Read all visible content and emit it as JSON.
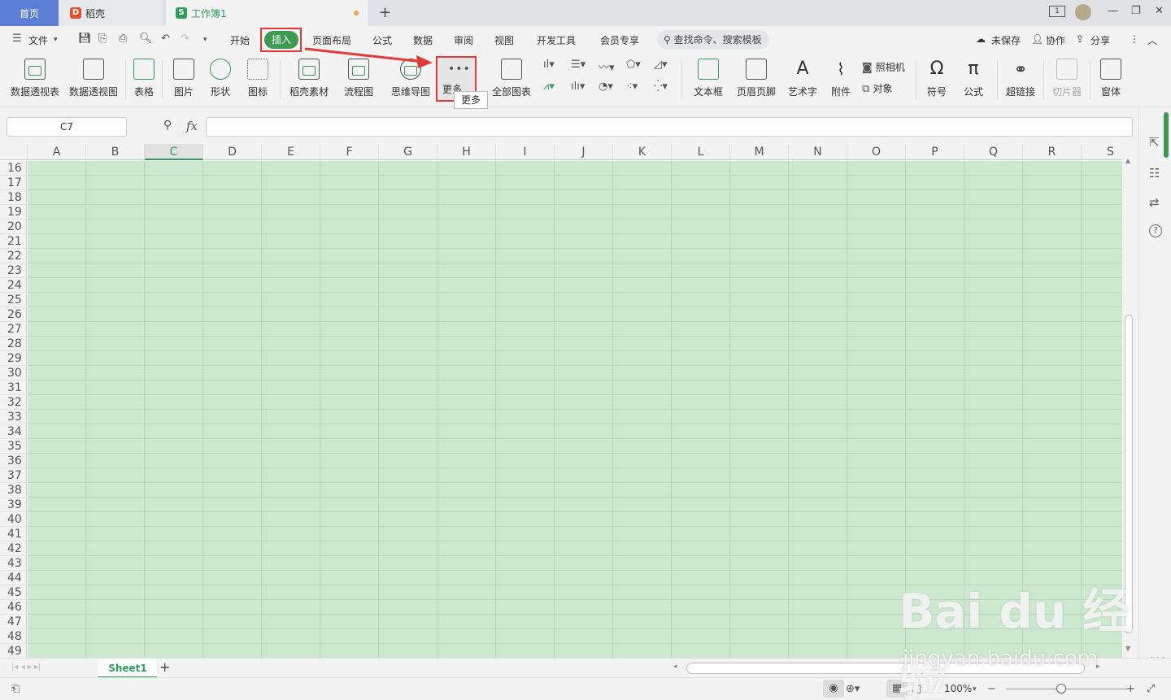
{
  "tabs": {
    "home": "首页",
    "daoke": "稻壳",
    "workbook": "工作簿1"
  },
  "menubar": {
    "file": "文件",
    "items": [
      "开始",
      "插入",
      "页面布局",
      "公式",
      "数据",
      "审阅",
      "视图",
      "开发工具",
      "会员专享"
    ],
    "search": "查找命令、搜索模板",
    "unsaved": "未保存",
    "collab": "协作",
    "share": "分享"
  },
  "ribbon": {
    "pivot_table": "数据透视表",
    "pivot_chart": "数据透视图",
    "table": "表格",
    "picture": "图片",
    "shape": "形状",
    "icon": "图标",
    "daoke_material": "稻壳素材",
    "flowchart": "流程图",
    "mindmap": "思维导图",
    "more": "更多",
    "all_charts": "全部图表",
    "textbox": "文本框",
    "header_footer": "页眉页脚",
    "wordart": "艺术字",
    "attachment": "附件",
    "camera": "照相机",
    "object": "对象",
    "symbol": "符号",
    "formula": "公式",
    "hyperlink": "超链接",
    "slicer": "切片器",
    "window": "窗体",
    "tooltip": "更多"
  },
  "formula_bar": {
    "cell_ref": "C7",
    "fx": "fx"
  },
  "columns": [
    "A",
    "B",
    "C",
    "D",
    "E",
    "F",
    "G",
    "H",
    "I",
    "J",
    "K",
    "L",
    "M",
    "N",
    "O",
    "P",
    "Q",
    "R",
    "S"
  ],
  "selected_column": "C",
  "rows": [
    "16",
    "17",
    "18",
    "19",
    "20",
    "21",
    "22",
    "23",
    "24",
    "25",
    "26",
    "27",
    "28",
    "29",
    "30",
    "31",
    "32",
    "33",
    "34",
    "35",
    "36",
    "37",
    "38",
    "39",
    "40",
    "41",
    "42",
    "43",
    "44",
    "45",
    "46",
    "47",
    "48",
    "49"
  ],
  "sheet": {
    "tab": "Sheet1"
  },
  "status": {
    "zoom": "100%"
  },
  "watermark": {
    "brand": "Bai du 经验",
    "url": "jingyan.baidu.com"
  },
  "colors": {
    "accent": "#2e9e5b",
    "highlight": "#e53935",
    "grid": "#cce8cf"
  }
}
